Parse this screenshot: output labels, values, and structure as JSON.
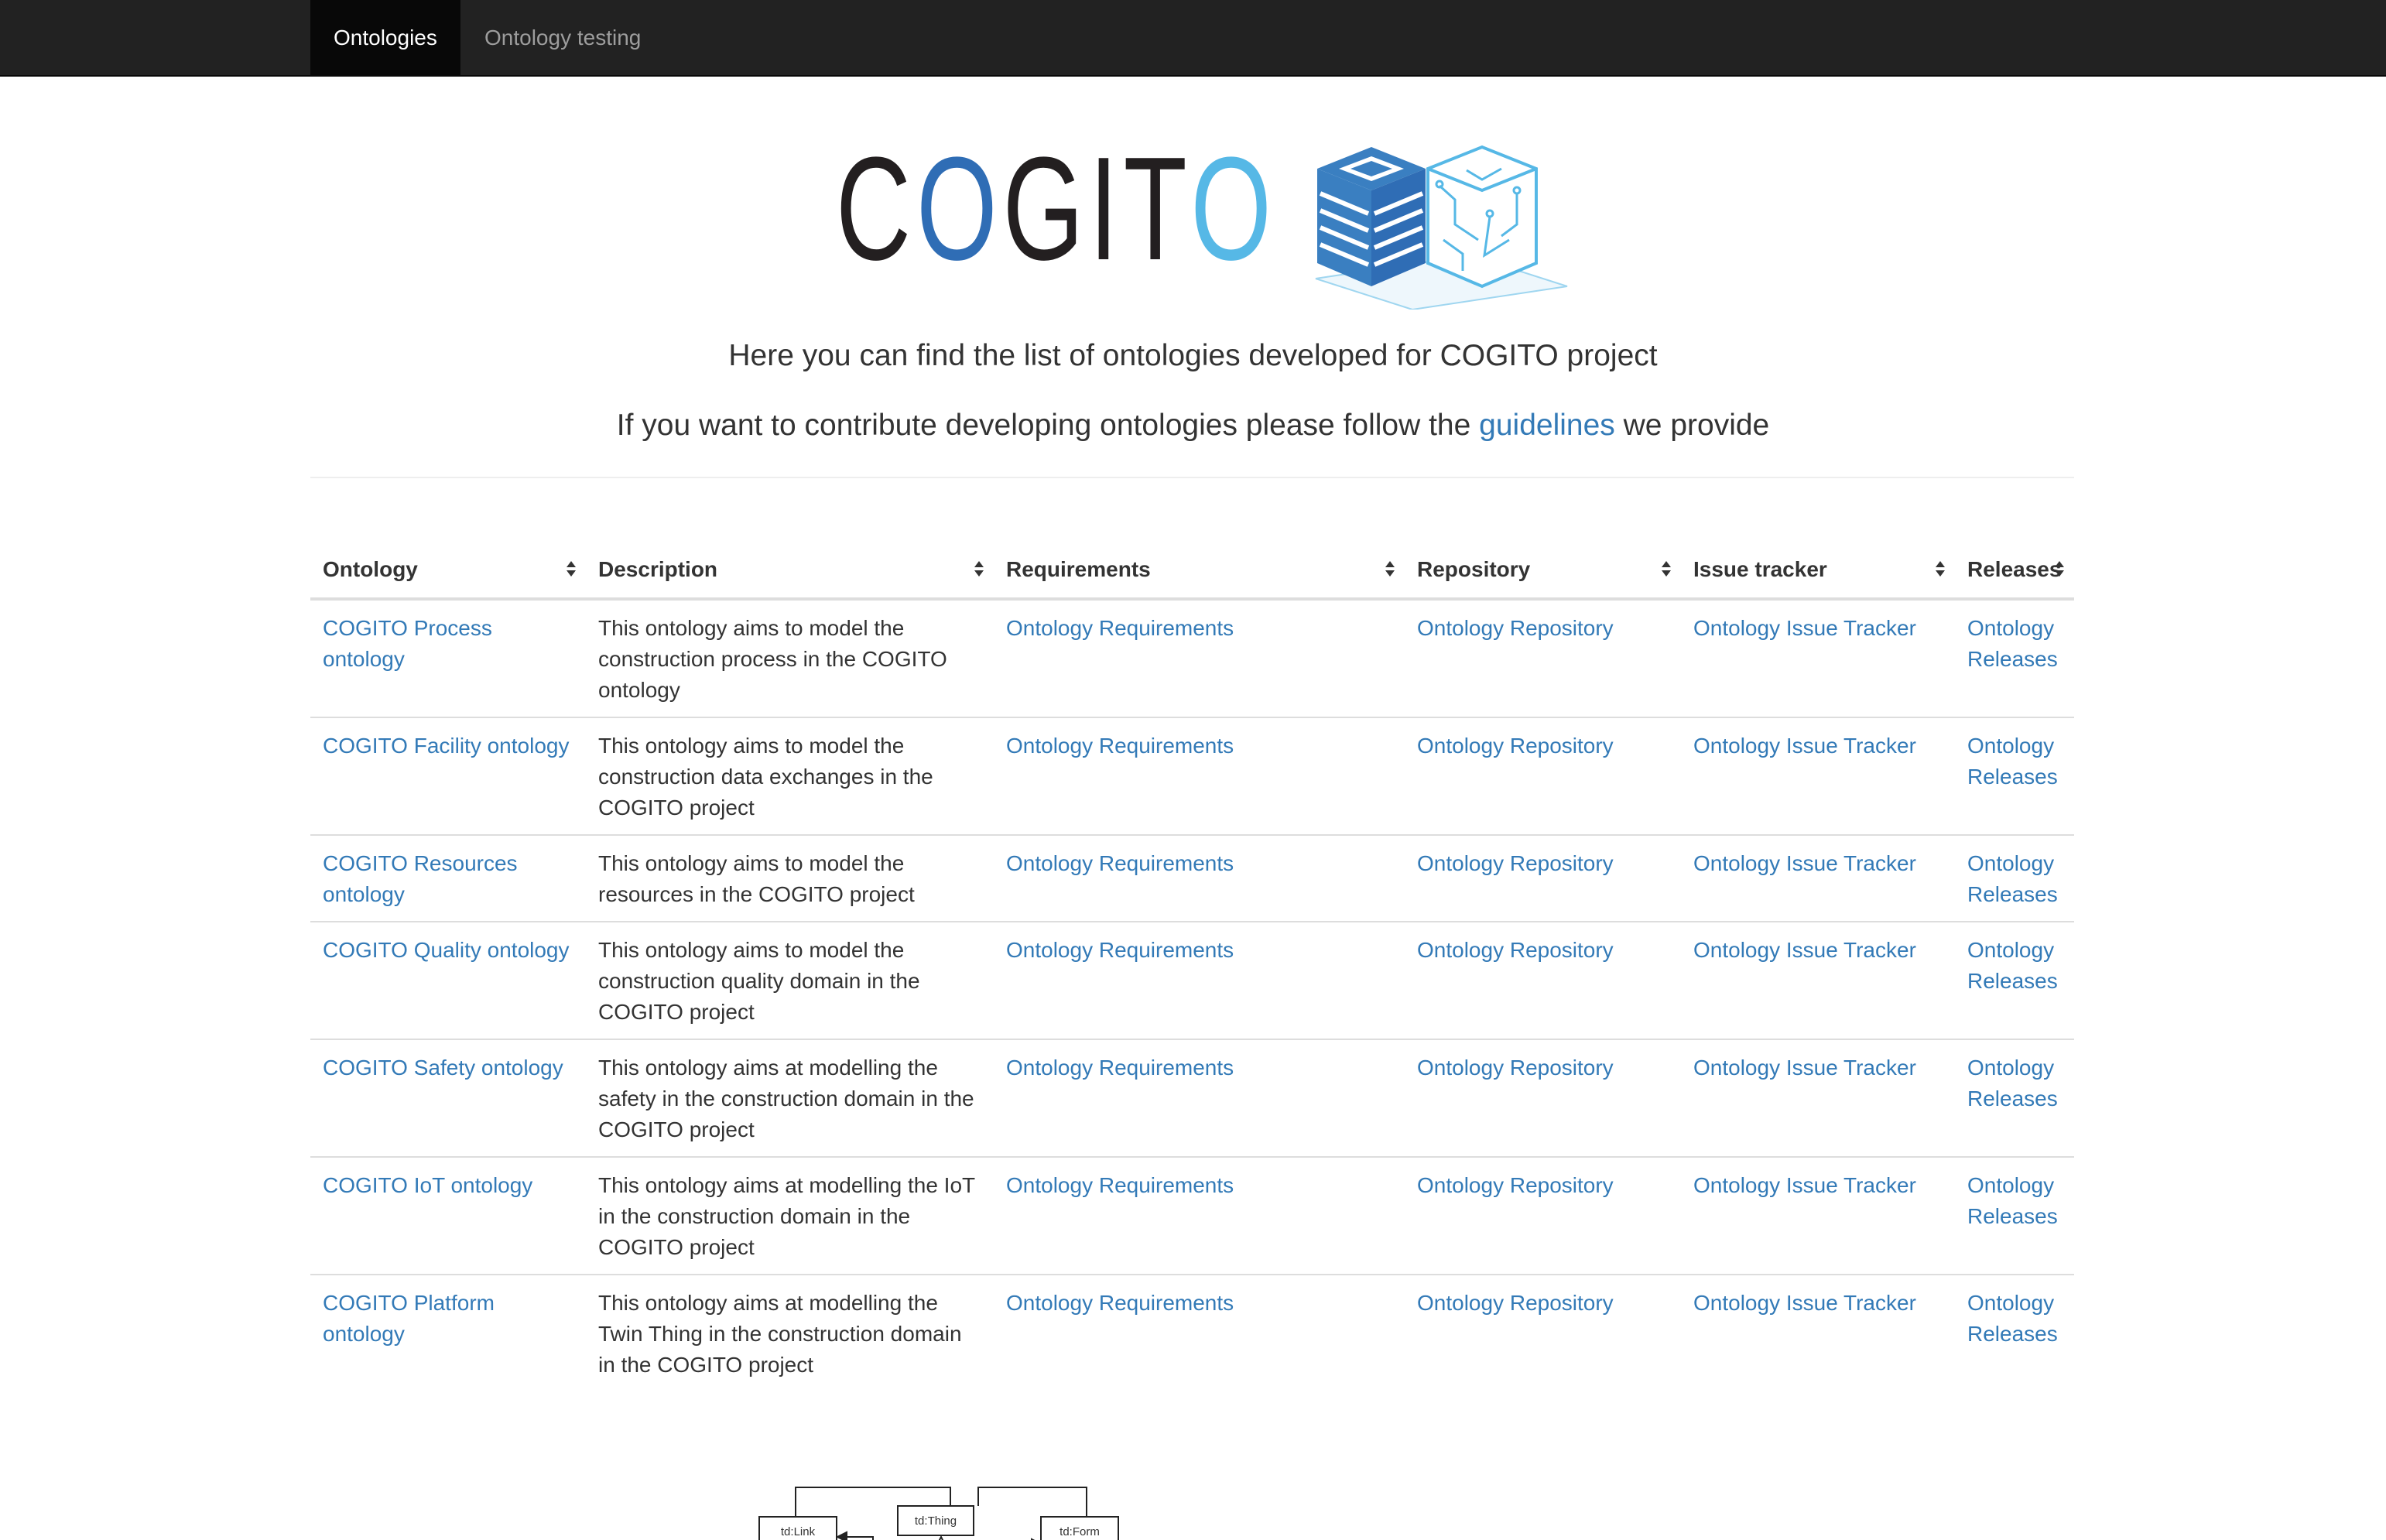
{
  "nav": {
    "items": [
      {
        "label": "Ontologies",
        "active": true
      },
      {
        "label": "Ontology testing",
        "active": false
      }
    ]
  },
  "logo": {
    "text_dark1": "C",
    "text_blue": "O",
    "text_dark2": "GIT",
    "text_light": "O",
    "colors": {
      "dark": "#231f20",
      "blue": "#2f6db5",
      "light": "#56b8e6"
    }
  },
  "intro": {
    "line1": "Here you can find the list of ontologies developed for COGITO project",
    "line2_before": "If you want to contribute developing ontologies please follow the ",
    "line2_link": "guidelines",
    "line2_after": " we provide"
  },
  "table": {
    "headers": [
      "Ontology",
      "Description",
      "Requirements",
      "Repository",
      "Issue tracker",
      "Releases"
    ],
    "rows": [
      {
        "ontology": "COGITO Process ontology",
        "description": "This ontology aims to model the construction process in the COGITO ontology",
        "requirements": "Ontology Requirements",
        "repository": "Ontology Repository",
        "issues": "Ontology Issue Tracker",
        "releases": "Ontology Releases"
      },
      {
        "ontology": "COGITO Facility ontology",
        "description": "This ontology aims to model the construction data exchanges in the COGITO project",
        "requirements": "Ontology Requirements",
        "repository": "Ontology Repository",
        "issues": "Ontology Issue Tracker",
        "releases": "Ontology Releases"
      },
      {
        "ontology": "COGITO Resources ontology",
        "description": "This ontology aims to model the resources in the COGITO project",
        "requirements": "Ontology Requirements",
        "repository": "Ontology Repository",
        "issues": "Ontology Issue Tracker",
        "releases": "Ontology Releases"
      },
      {
        "ontology": "COGITO Quality ontology",
        "description": "This ontology aims to model the construction quality domain in the COGITO project",
        "requirements": "Ontology Requirements",
        "repository": "Ontology Repository",
        "issues": "Ontology Issue Tracker",
        "releases": "Ontology Releases"
      },
      {
        "ontology": "COGITO Safety ontology",
        "description": "This ontology aims at modelling the safety in the construction domain in the COGITO project",
        "requirements": "Ontology Requirements",
        "repository": "Ontology Repository",
        "issues": "Ontology Issue Tracker",
        "releases": "Ontology Releases"
      },
      {
        "ontology": "COGITO IoT ontology",
        "description": "This ontology aims at modelling the IoT in the construction domain in the COGITO project",
        "requirements": "Ontology Requirements",
        "repository": "Ontology Repository",
        "issues": "Ontology Issue Tracker",
        "releases": "Ontology Releases"
      },
      {
        "ontology": "COGITO Platform ontology",
        "description": "This ontology aims at modelling the Twin Thing in the construction domain in the COGITO project",
        "requirements": "Ontology Requirements",
        "repository": "Ontology Repository",
        "issues": "Ontology Issue Tracker",
        "releases": "Ontology Releases"
      }
    ]
  },
  "diagram": {
    "nodes": [
      "td:Link",
      "td:Thing",
      "td:Form"
    ]
  },
  "colors": {
    "link": "#337ab7",
    "navbar": "#222222"
  }
}
